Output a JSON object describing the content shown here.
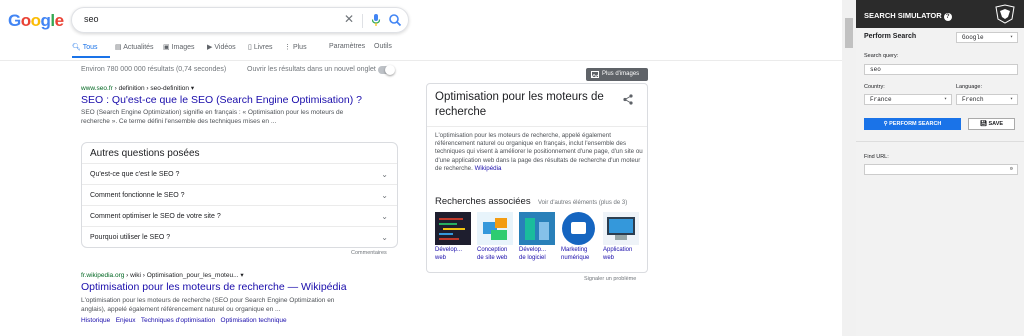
{
  "logo": {
    "letters": [
      "G",
      "o",
      "o",
      "g",
      "l",
      "e"
    ],
    "colors": [
      "#4285f4",
      "#ea4335",
      "#fbbc05",
      "#4285f4",
      "#34a853",
      "#ea4335"
    ]
  },
  "search": {
    "query": "seo"
  },
  "tabs": [
    {
      "icon": "search-icon",
      "label": "Tous"
    },
    {
      "icon": "news-icon",
      "label": "Actualités"
    },
    {
      "icon": "image-icon",
      "label": "Images"
    },
    {
      "icon": "video-icon",
      "label": "Vidéos"
    },
    {
      "icon": "book-icon",
      "label": "Livres"
    },
    {
      "icon": "more-icon",
      "label": "Plus"
    },
    {
      "icon": "",
      "label": "Paramètres"
    },
    {
      "icon": "",
      "label": "Outils"
    }
  ],
  "stats": "Environ 780 000 000 résultats (0,74 secondes)",
  "new_tab": "Ouvrir les résultats dans un nouvel onglet",
  "result1": {
    "host": "www.seo.fr",
    "path": " › definition › seo-definition",
    "title": "SEO : Qu'est-ce que le SEO (Search Engine Optimisation) ?",
    "snippet_line1": "SEO (Search Engine Optimization) signifie en français : « Optimisation pour les moteurs de",
    "snippet_line2": "recherche ». Ce terme défini l'ensemble des techniques mises en ..."
  },
  "paa": {
    "title": "Autres questions posées",
    "questions": [
      "Qu'est-ce que c'est le SEO ?",
      "Comment fonctionne le SEO ?",
      "Comment optimiser le SEO de votre site ?",
      "Pourquoi utiliser le SEO ?"
    ],
    "comments": "Commentaires"
  },
  "result2": {
    "host": "fr.wikipedia.org",
    "path": " › wiki › Optimisation_pour_les_moteu...",
    "title": "Optimisation pour les moteurs de recherche — Wikipédia",
    "snippet_line1": "L'optimisation pour les moteurs de recherche (SEO pour Search Engine Optimization en",
    "snippet_line2": "anglais), appelé également référencement naturel ou organique en ...",
    "links": [
      "Historique",
      "Enjeux",
      "Techniques d'optimisation",
      "Optimisation technique"
    ]
  },
  "more_images": "Plus d'images",
  "knowledge": {
    "title": "Optimisation pour les moteurs de recherche",
    "description": "L'optimisation pour les moteurs de recherche, appelé également référencement naturel ou organique en français, inclut l'ensemble des techniques qui visent à améliorer le positionnement d'une page, d'un site ou d'une application web dans la page des résultats de recherche d'un moteur de recherche.",
    "source": "Wikipédia",
    "related_title": "Recherches associées",
    "more": "Voir d'autres éléments (plus de 3)",
    "related": [
      {
        "label": "Développement web",
        "colors": [
          "#1e1e2e",
          "#c0392b"
        ]
      },
      {
        "label": "Conception de site web",
        "colors": [
          "#e8f4fb",
          "#f39c12"
        ]
      },
      {
        "label": "Développement de logiciel",
        "colors": [
          "#2980b9",
          "#1abc9c"
        ]
      },
      {
        "label": "Marketing numérique",
        "colors": [
          "#1565c0",
          "#ffffff"
        ]
      },
      {
        "label": "Application web",
        "colors": [
          "#eef3f8",
          "#3498db"
        ]
      }
    ],
    "related_lines": [
      [
        "Dévelop...",
        "web"
      ],
      [
        "Conception",
        "de site web"
      ],
      [
        "Dévelop...",
        "de logiciel"
      ],
      [
        "Marketing",
        "numérique"
      ],
      [
        "Application",
        "web"
      ]
    ]
  },
  "report": "Signaler un problème",
  "panel": {
    "title": "SEARCH SIMULATOR",
    "perform_label": "Perform Search",
    "engine": "Google",
    "query_label": "Search query:",
    "query": "seo",
    "country_label": "Country:",
    "country": "France",
    "language_label": "Language:",
    "language": "French",
    "perform_button": "PERFORM SEARCH",
    "save_button": "SAVE",
    "find_url_label": "Find URL:",
    "find_url": ""
  },
  "colors": {
    "link": "#1a0dab",
    "accent": "#1a73e8",
    "url_green": "#006621"
  }
}
